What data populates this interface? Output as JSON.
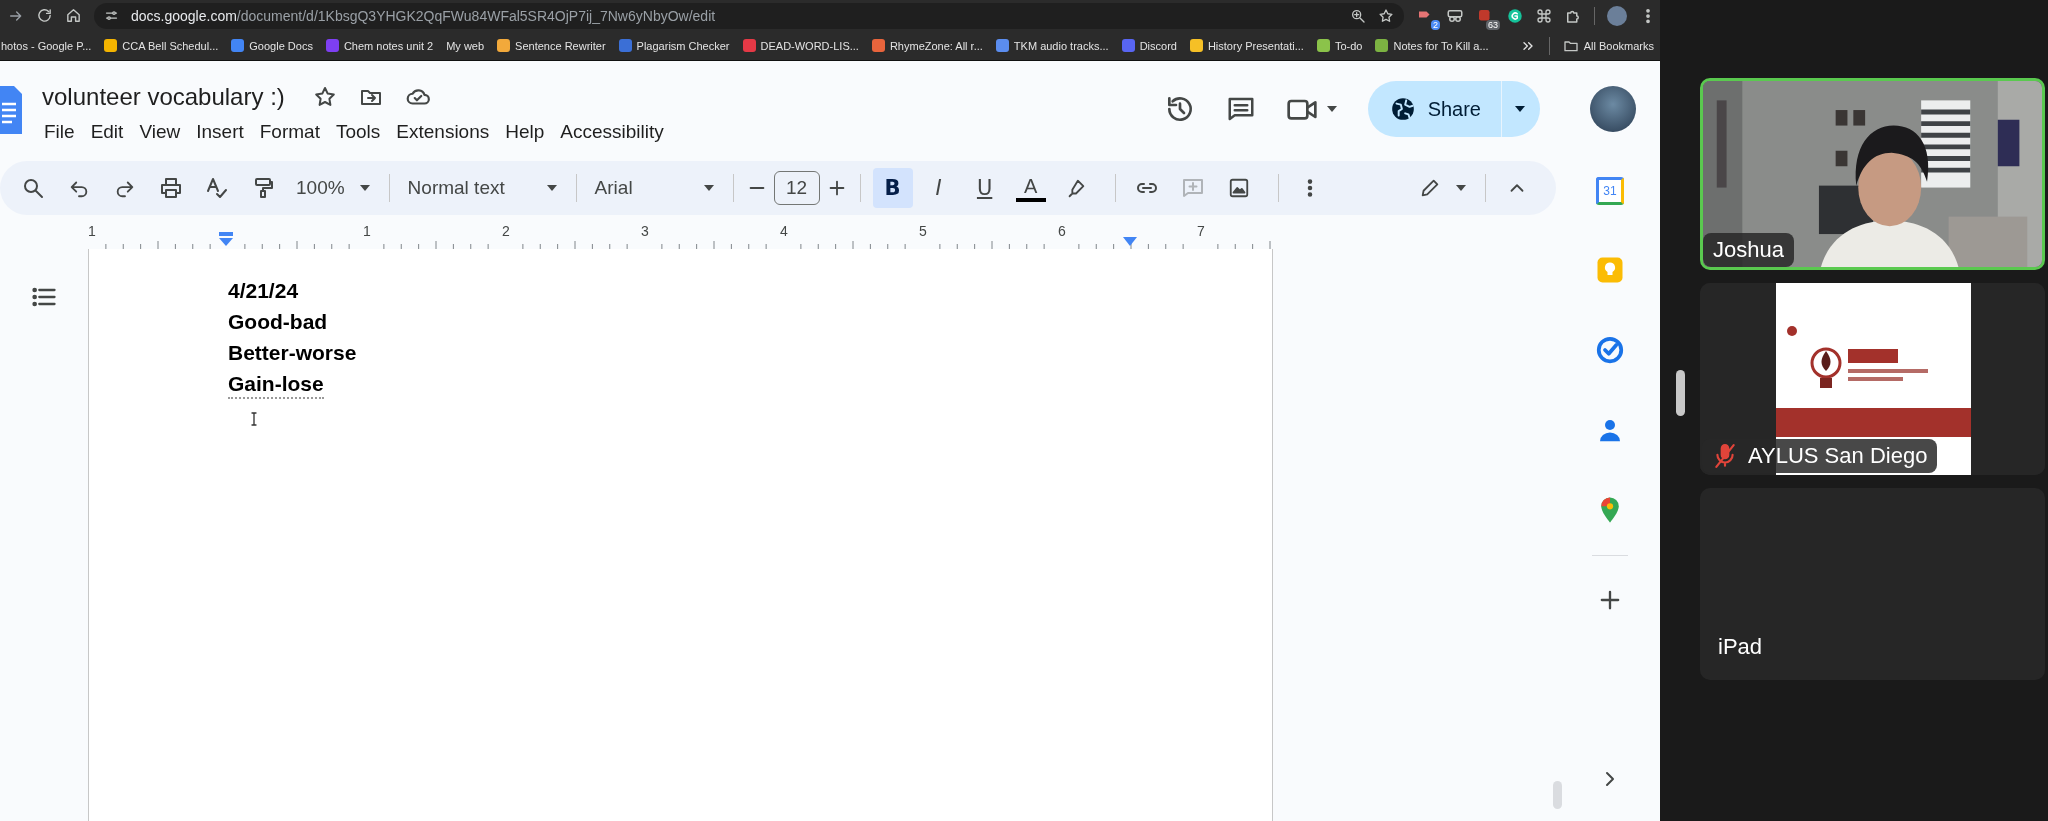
{
  "browser": {
    "url_host": "docs.google.com",
    "url_path": "/document/d/1KbsgQ3YHGK2QqFWu84WFal5SR4OjP7ij_7Nw6yNbyOw/edit",
    "extension_badges": [
      {
        "text": "2",
        "color": "#4c8bf5"
      },
      {
        "text": "63",
        "color": "#5f6368"
      }
    ],
    "bookmarks": [
      {
        "label": "hotos - Google P..."
      },
      {
        "label": "CCA Bell Schedul...",
        "color": "#f4b400"
      },
      {
        "label": "Google Docs",
        "color": "#4285f4"
      },
      {
        "label": "Chem notes unit 2",
        "color": "#7e3ff2"
      },
      {
        "label": "My web"
      },
      {
        "label": "Sentence Rewriter",
        "color": "#f2a93b"
      },
      {
        "label": "Plagarism Checker",
        "color": "#3b6fd6"
      },
      {
        "label": "DEAD-WORD-LIS...",
        "color": "#e53946"
      },
      {
        "label": "RhymeZone: All r...",
        "color": "#e8643c"
      },
      {
        "label": "TKM audio tracks...",
        "color": "#5b8def"
      },
      {
        "label": "Discord",
        "color": "#5865f2"
      },
      {
        "label": "History Presentati...",
        "color": "#f6c026"
      },
      {
        "label": "To-do",
        "color": "#8bc34a"
      },
      {
        "label": "Notes for To Kill a...",
        "color": "#7cb342"
      }
    ],
    "all_bookmarks": "All Bookmarks"
  },
  "docs": {
    "title": "volunteer vocabulary :)",
    "menus": [
      "File",
      "Edit",
      "View",
      "Insert",
      "Format",
      "Tools",
      "Extensions",
      "Help",
      "Accessibility"
    ],
    "share": "Share",
    "toolbar": {
      "zoom": "100%",
      "style": "Normal text",
      "font": "Arial",
      "font_size": "12",
      "format_buttons": [
        {
          "label": "B",
          "kind": "bold",
          "selected": true
        },
        {
          "label": "I",
          "kind": "italic",
          "selected": false
        },
        {
          "label": "U",
          "kind": "underline",
          "selected": false
        }
      ],
      "text_color": {
        "label": "A",
        "color": "#000000"
      }
    },
    "ruler": [
      "1",
      "1",
      "2",
      "3",
      "4",
      "5",
      "6",
      "7"
    ],
    "lines": [
      {
        "text": "4/21/24",
        "flagged": false
      },
      {
        "text": "Good-bad",
        "flagged": false
      },
      {
        "text": "Better-worse",
        "flagged": false
      },
      {
        "text": "Gain-lose",
        "flagged": true
      }
    ],
    "calendar_day": "31"
  },
  "participants": [
    {
      "name": "Joshua",
      "kind": "video",
      "speaking": true,
      "muted": false
    },
    {
      "name": "AYLUS San Diego",
      "kind": "avatar",
      "speaking": false,
      "muted": true
    },
    {
      "name": "iPad",
      "kind": "none",
      "speaking": false,
      "muted": false
    }
  ]
}
